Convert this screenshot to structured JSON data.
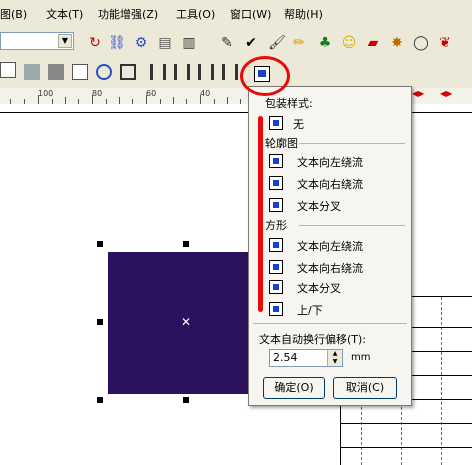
{
  "menubar": {
    "items": [
      "图(B)",
      "文本(T)",
      "功能增强(Z)",
      "工具(O)",
      "窗口(W)",
      "帮助(H)"
    ]
  },
  "ruler": {
    "labels": [
      "100",
      "80",
      "60",
      "40"
    ]
  },
  "popup": {
    "section_wrap_style": "包装样式:",
    "item_none": "无",
    "section_outline": "轮廓图",
    "outline_items": [
      "文本向左绕流",
      "文本向右绕流",
      "文本分叉"
    ],
    "section_square": "方形",
    "square_items": [
      "文本向左绕流",
      "文本向右绕流",
      "文本分叉",
      "上/下"
    ],
    "offset_label": "文本自动换行偏移(T):",
    "offset_value": "2.54",
    "offset_unit": "mm",
    "ok_label": "确定(O)",
    "cancel_label": "取消(C)"
  },
  "colors": {
    "object_fill": "#2c115e",
    "annotation": "#ea0a0a",
    "icon_accent": "#1b3fd2"
  }
}
